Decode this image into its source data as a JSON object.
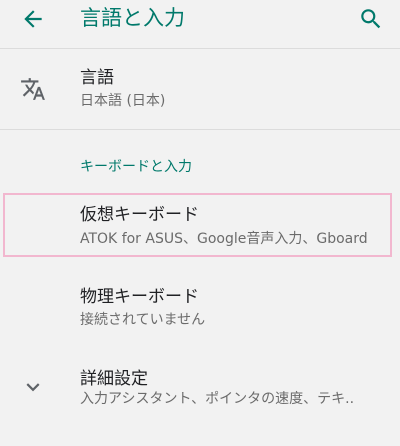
{
  "appbar": {
    "title": "言語と入力",
    "back_icon": "arrow-left-icon",
    "search_icon": "search-icon",
    "accent": "#00796b"
  },
  "language": {
    "label": "言語",
    "value": "日本語 (日本)",
    "icon": "translate-icon"
  },
  "keyboard_section": {
    "header": "キーボードと入力"
  },
  "items": [
    {
      "label": "仮想キーボード",
      "value": "ATOK for ASUS、Google音声入力、Gboard"
    },
    {
      "label": "物理キーボード",
      "value": "接続されていません"
    },
    {
      "label": "詳細設定",
      "value": "入力アシスタント、ポインタの速度、テキ..",
      "icon": "chevron-down-icon"
    }
  ]
}
